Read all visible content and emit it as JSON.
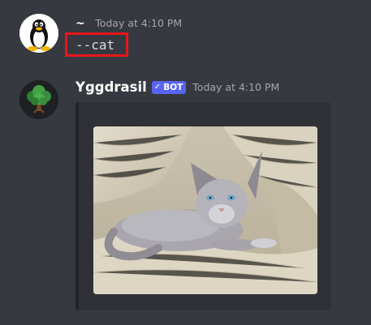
{
  "messages": [
    {
      "author": "~",
      "timestamp": "Today at 4:10 PM",
      "content": "--cat",
      "avatar_icon": "linux-penguin-icon",
      "highlight_color": "#e8161c"
    },
    {
      "author": "Yggdrasil",
      "badge": "BOT",
      "badge_check": "✓",
      "timestamp": "Today at 4:10 PM",
      "avatar_icon": "tree-icon",
      "embed": {
        "image_icon": "cat-photo",
        "border_color": "#202225"
      }
    }
  ],
  "colors": {
    "background": "#36393f",
    "embed_background": "#2f3136",
    "bot_badge": "#5865f2"
  }
}
